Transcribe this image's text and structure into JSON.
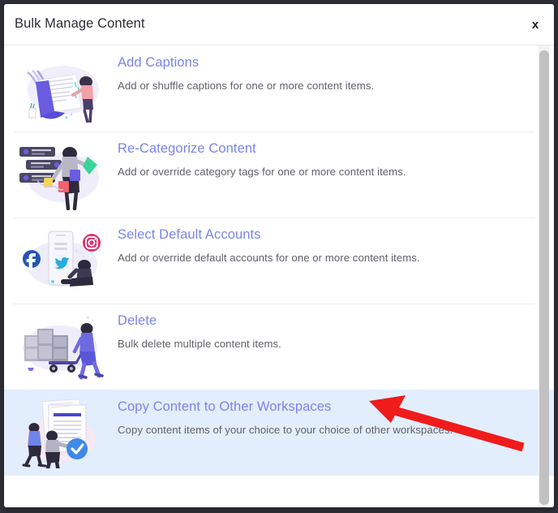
{
  "window": {
    "backdrop_color": "#2f3037"
  },
  "modal": {
    "title": "Bulk Manage Content",
    "close_label": "x"
  },
  "theme": {
    "link_color": "#7b85e8",
    "desc_color": "#61616a",
    "selected_row_bg": "#e3eefc",
    "annotation_arrow_color": "#f01b1b",
    "scrollbar_color": "#c1c1c1"
  },
  "options": [
    {
      "icon": "captions-illustration",
      "title": "Add Captions",
      "description": "Add or shuffle captions for one or more content items.",
      "selected": false
    },
    {
      "icon": "recategorize-illustration",
      "title": "Re-Categorize Content",
      "description": "Add or override category tags for one or more content items.",
      "selected": false
    },
    {
      "icon": "default-accounts-illustration",
      "title": "Select Default Accounts",
      "description": "Add or override default accounts for one or more content items.",
      "selected": false
    },
    {
      "icon": "delete-illustration",
      "title": "Delete",
      "description": "Bulk delete multiple content items.",
      "selected": false
    },
    {
      "icon": "copy-workspaces-illustration",
      "title": "Copy Content to Other Workspaces",
      "description": "Copy content items of your choice to your choice of other workspaces.",
      "selected": true
    }
  ],
  "annotation": {
    "type": "red-arrow",
    "points_to": "Copy Content to Other Workspaces"
  }
}
